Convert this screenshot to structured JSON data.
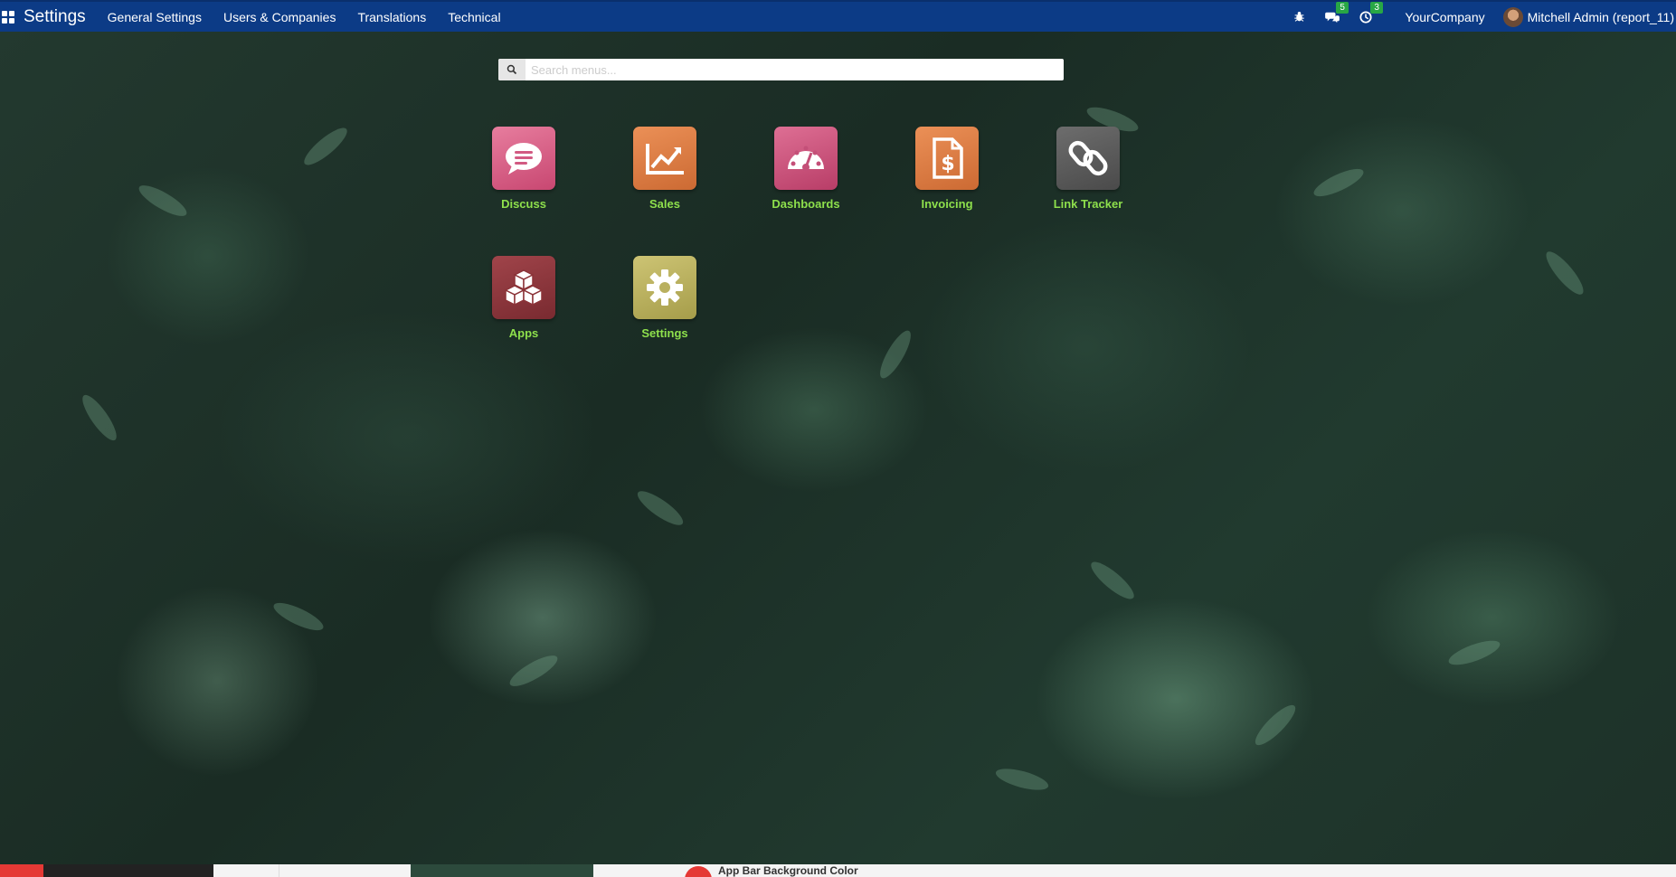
{
  "navbar": {
    "title": "Settings",
    "menu": [
      "General Settings",
      "Users & Companies",
      "Translations",
      "Technical"
    ],
    "messages_count": "5",
    "activities_count": "3",
    "company": "YourCompany",
    "user": "Mitchell Admin (report_11)"
  },
  "search": {
    "placeholder": "Search menus..."
  },
  "apps": [
    {
      "label": "Discuss",
      "icon": "chat-icon",
      "color": "#d85b84"
    },
    {
      "label": "Sales",
      "icon": "chart-line-icon",
      "color": "#e07a3e"
    },
    {
      "label": "Dashboards",
      "icon": "gauge-icon",
      "color": "#c95079"
    },
    {
      "label": "Invoicing",
      "icon": "invoice-dollar-icon",
      "color": "#e07a3e"
    },
    {
      "label": "Link Tracker",
      "icon": "link-icon",
      "color": "#5b5b5b"
    },
    {
      "label": "Apps",
      "icon": "cubes-icon",
      "color": "#8b3338"
    },
    {
      "label": "Settings",
      "icon": "gear-icon",
      "color": "#b9b05f"
    }
  ],
  "bottom_bar": {
    "label": "App Bar Background Color"
  },
  "colors": {
    "navbar": "#0c3b86",
    "app_label": "#8ee04c",
    "badge": "#28a745"
  }
}
